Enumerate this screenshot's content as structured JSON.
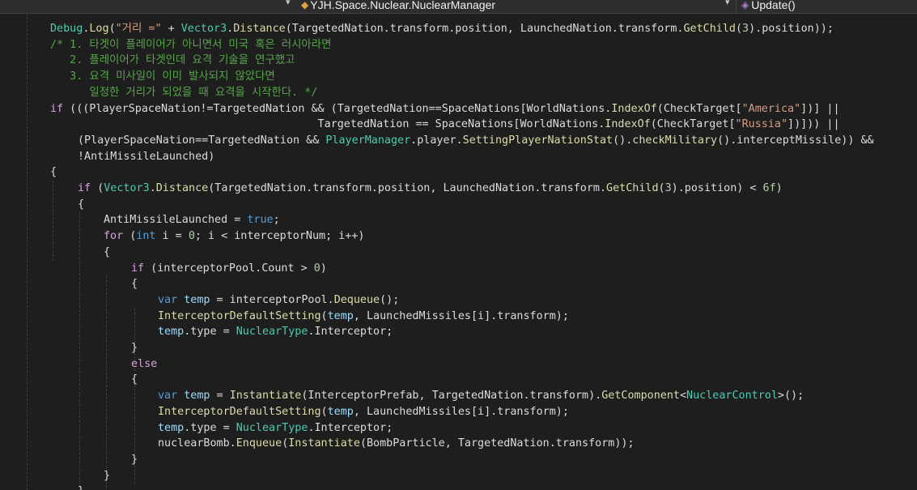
{
  "navbar": {
    "class_path": "YJH.Space.Nuclear.NuclearManager",
    "method": "Update()",
    "dropdown_glyph": "▾",
    "class_icon": "class-icon",
    "method_icon": "method-icon"
  },
  "code_lines": [
    {
      "indent": 1,
      "tokens": [
        {
          "t": "Debug",
          "c": "type"
        },
        {
          "t": ".",
          "c": "default"
        },
        {
          "t": "Log",
          "c": "method"
        },
        {
          "t": "(",
          "c": "default"
        },
        {
          "t": "\"거리 =\"",
          "c": "string"
        },
        {
          "t": " + ",
          "c": "default"
        },
        {
          "t": "Vector3",
          "c": "type"
        },
        {
          "t": ".",
          "c": "default"
        },
        {
          "t": "Distance",
          "c": "method"
        },
        {
          "t": "(TargetedNation.transform.position, LaunchedNation.transform.",
          "c": "default"
        },
        {
          "t": "GetChild",
          "c": "method"
        },
        {
          "t": "(",
          "c": "default"
        },
        {
          "t": "3",
          "c": "number"
        },
        {
          "t": ").position));",
          "c": "default"
        }
      ]
    },
    {
      "indent": 1,
      "tokens": [
        {
          "t": "/* 1. 타겟이 플레이어가 아니면서 미국 혹은 러시아라면",
          "c": "comment"
        }
      ]
    },
    {
      "indent": 1,
      "tokens": [
        {
          "t": "   2. 플레이어가 타겟인데 요격 기술을 연구했고",
          "c": "comment"
        }
      ]
    },
    {
      "indent": 1,
      "tokens": [
        {
          "t": "   3. 요격 미사일이 이미 발사되지 않았다면",
          "c": "comment"
        }
      ]
    },
    {
      "indent": 1,
      "tokens": [
        {
          "t": "      일정한 거리가 되었을 때 요격을 시작한다. */",
          "c": "comment"
        }
      ]
    },
    {
      "indent": 1,
      "tokens": [
        {
          "t": "if",
          "c": "control"
        },
        {
          "t": " (((PlayerSpaceNation!=TargetedNation && (TargetedNation==SpaceNations[WorldNations.",
          "c": "default"
        },
        {
          "t": "IndexOf",
          "c": "method"
        },
        {
          "t": "(CheckTarget[",
          "c": "default"
        },
        {
          "t": "\"America\"",
          "c": "string"
        },
        {
          "t": "])] ||",
          "c": "default"
        }
      ]
    },
    {
      "indent": 1,
      "tokens": [
        {
          "t": "                                         TargetedNation == SpaceNations[WorldNations.",
          "c": "default"
        },
        {
          "t": "IndexOf",
          "c": "method"
        },
        {
          "t": "(CheckTarget[",
          "c": "default"
        },
        {
          "t": "\"Russia\"",
          "c": "string"
        },
        {
          "t": "])])) ||",
          "c": "default"
        }
      ]
    },
    {
      "indent": 2,
      "tokens": [
        {
          "t": "(PlayerSpaceNation==TargetedNation && ",
          "c": "default"
        },
        {
          "t": "PlayerManager",
          "c": "type"
        },
        {
          "t": ".player.",
          "c": "default"
        },
        {
          "t": "SettingPlayerNationStat",
          "c": "method"
        },
        {
          "t": "().",
          "c": "default"
        },
        {
          "t": "checkMilitary",
          "c": "method"
        },
        {
          "t": "().interceptMissile)) &&",
          "c": "default"
        }
      ]
    },
    {
      "indent": 2,
      "tokens": [
        {
          "t": "!AntiMissileLaunched)",
          "c": "default"
        }
      ]
    },
    {
      "indent": 1,
      "tokens": [
        {
          "t": "{",
          "c": "default"
        }
      ]
    },
    {
      "indent": 2,
      "tokens": [
        {
          "t": "if",
          "c": "control"
        },
        {
          "t": " (",
          "c": "default"
        },
        {
          "t": "Vector3",
          "c": "type"
        },
        {
          "t": ".",
          "c": "default"
        },
        {
          "t": "Distance",
          "c": "method"
        },
        {
          "t": "(TargetedNation.transform.position, LaunchedNation.transform.",
          "c": "default"
        },
        {
          "t": "GetChild",
          "c": "method"
        },
        {
          "t": "(",
          "c": "default"
        },
        {
          "t": "3",
          "c": "number"
        },
        {
          "t": ").position) < ",
          "c": "default"
        },
        {
          "t": "6f",
          "c": "number"
        },
        {
          "t": ")",
          "c": "default"
        }
      ]
    },
    {
      "indent": 2,
      "tokens": [
        {
          "t": "{",
          "c": "default"
        }
      ]
    },
    {
      "indent": 3,
      "tokens": [
        {
          "t": "AntiMissileLaunched = ",
          "c": "default"
        },
        {
          "t": "true",
          "c": "keyword"
        },
        {
          "t": ";",
          "c": "default"
        }
      ]
    },
    {
      "indent": 3,
      "tokens": [
        {
          "t": "for",
          "c": "control"
        },
        {
          "t": " (",
          "c": "default"
        },
        {
          "t": "int",
          "c": "keyword"
        },
        {
          "t": " i = ",
          "c": "default"
        },
        {
          "t": "0",
          "c": "number"
        },
        {
          "t": "; i < interceptorNum; i++)",
          "c": "default"
        }
      ]
    },
    {
      "indent": 3,
      "tokens": [
        {
          "t": "{",
          "c": "default"
        }
      ]
    },
    {
      "indent": 4,
      "tokens": [
        {
          "t": "if",
          "c": "control"
        },
        {
          "t": " (interceptorPool.Count > ",
          "c": "default"
        },
        {
          "t": "0",
          "c": "number"
        },
        {
          "t": ")",
          "c": "default"
        }
      ]
    },
    {
      "indent": 4,
      "tokens": [
        {
          "t": "{",
          "c": "default"
        }
      ]
    },
    {
      "indent": 5,
      "tokens": [
        {
          "t": "var",
          "c": "keyword"
        },
        {
          "t": " ",
          "c": "default"
        },
        {
          "t": "temp",
          "c": "local"
        },
        {
          "t": " = interceptorPool.",
          "c": "default"
        },
        {
          "t": "Dequeue",
          "c": "method"
        },
        {
          "t": "();",
          "c": "default"
        }
      ]
    },
    {
      "indent": 5,
      "tokens": [
        {
          "t": "InterceptorDefaultSetting",
          "c": "method"
        },
        {
          "t": "(",
          "c": "default"
        },
        {
          "t": "temp",
          "c": "local"
        },
        {
          "t": ", LaunchedMissiles[i].transform);",
          "c": "default"
        }
      ]
    },
    {
      "indent": 5,
      "tokens": [
        {
          "t": "temp",
          "c": "local"
        },
        {
          "t": ".type = ",
          "c": "default"
        },
        {
          "t": "NuclearType",
          "c": "type"
        },
        {
          "t": ".Interceptor;",
          "c": "default"
        }
      ]
    },
    {
      "indent": 4,
      "tokens": [
        {
          "t": "}",
          "c": "default"
        }
      ]
    },
    {
      "indent": 4,
      "tokens": [
        {
          "t": "else",
          "c": "control"
        }
      ]
    },
    {
      "indent": 4,
      "tokens": [
        {
          "t": "{",
          "c": "default"
        }
      ]
    },
    {
      "indent": 5,
      "tokens": [
        {
          "t": "var",
          "c": "keyword"
        },
        {
          "t": " ",
          "c": "default"
        },
        {
          "t": "temp",
          "c": "local"
        },
        {
          "t": " = ",
          "c": "default"
        },
        {
          "t": "Instantiate",
          "c": "method"
        },
        {
          "t": "(InterceptorPrefab, TargetedNation.transform).",
          "c": "default"
        },
        {
          "t": "GetComponent",
          "c": "method"
        },
        {
          "t": "<",
          "c": "default"
        },
        {
          "t": "NuclearControl",
          "c": "type"
        },
        {
          "t": ">();",
          "c": "default"
        }
      ]
    },
    {
      "indent": 5,
      "tokens": [
        {
          "t": "InterceptorDefaultSetting",
          "c": "method"
        },
        {
          "t": "(",
          "c": "default"
        },
        {
          "t": "temp",
          "c": "local"
        },
        {
          "t": ", LaunchedMissiles[i].transform);",
          "c": "default"
        }
      ]
    },
    {
      "indent": 5,
      "tokens": [
        {
          "t": "temp",
          "c": "local"
        },
        {
          "t": ".type = ",
          "c": "default"
        },
        {
          "t": "NuclearType",
          "c": "type"
        },
        {
          "t": ".Interceptor;",
          "c": "default"
        }
      ]
    },
    {
      "indent": 5,
      "tokens": [
        {
          "t": "nuclearBomb.",
          "c": "default"
        },
        {
          "t": "Enqueue",
          "c": "method"
        },
        {
          "t": "(",
          "c": "default"
        },
        {
          "t": "Instantiate",
          "c": "method"
        },
        {
          "t": "(BombParticle, TargetedNation.transform));",
          "c": "default"
        }
      ]
    },
    {
      "indent": 4,
      "tokens": [
        {
          "t": "}",
          "c": "default"
        }
      ]
    },
    {
      "indent": 3,
      "tokens": [
        {
          "t": "}",
          "c": "default"
        }
      ]
    },
    {
      "indent": 2,
      "tokens": [
        {
          "t": "}",
          "c": "default"
        }
      ]
    }
  ]
}
